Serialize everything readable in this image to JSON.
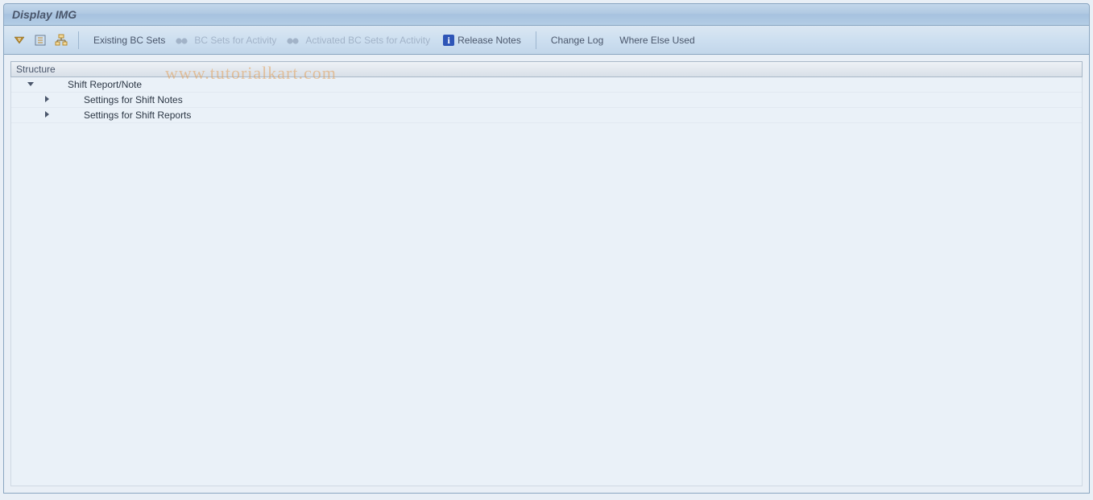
{
  "titlebar": {
    "title": "Display IMG"
  },
  "toolbar": {
    "existing_bc_sets": "Existing BC Sets",
    "bc_sets_for_activity": "BC Sets for Activity",
    "activated_bc_sets_for_activity": "Activated BC Sets for Activity",
    "release_notes": "Release Notes",
    "change_log": "Change Log",
    "where_else_used": "Where Else Used"
  },
  "watermark": "www.tutorialkart.com",
  "tree": {
    "header": "Structure",
    "nodes": [
      {
        "label": "Shift Report/Note",
        "expanded": true,
        "level": 1
      },
      {
        "label": "Settings for Shift Notes",
        "expanded": false,
        "level": 2
      },
      {
        "label": "Settings for Shift Reports",
        "expanded": false,
        "level": 2
      }
    ]
  }
}
